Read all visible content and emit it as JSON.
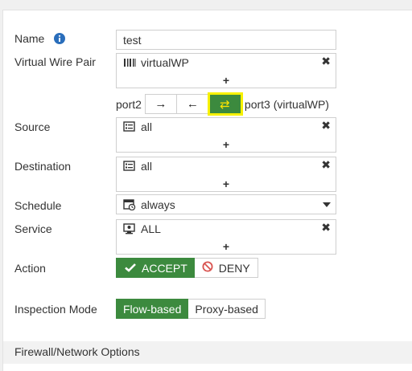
{
  "form": {
    "name_label": "Name",
    "name_value": "test",
    "vwp_label": "Virtual Wire Pair",
    "vwp_value": "virtualWP",
    "port_left": "port2",
    "port_right": "port3 (virtualWP)",
    "directions": [
      {
        "name": "right",
        "glyph": "→",
        "active": false
      },
      {
        "name": "left",
        "glyph": "←",
        "active": false
      },
      {
        "name": "both",
        "glyph": "⇄",
        "active": true
      }
    ],
    "source_label": "Source",
    "source_value": "all",
    "destination_label": "Destination",
    "destination_value": "all",
    "schedule_label": "Schedule",
    "schedule_value": "always",
    "service_label": "Service",
    "service_value": "ALL",
    "action_label": "Action",
    "action_accept": "ACCEPT",
    "action_deny": "DENY",
    "inspection_label": "Inspection Mode",
    "inspection_flow": "Flow-based",
    "inspection_proxy": "Proxy-based",
    "remove_glyph": "✖",
    "add_glyph": "+"
  },
  "sections": {
    "firewall_options": "Firewall/Network Options"
  },
  "colors": {
    "accent_green": "#3c8a3e",
    "highlight_yellow": "#f7f100",
    "deny_red": "#d9534f",
    "info_blue": "#2a6ebb"
  }
}
